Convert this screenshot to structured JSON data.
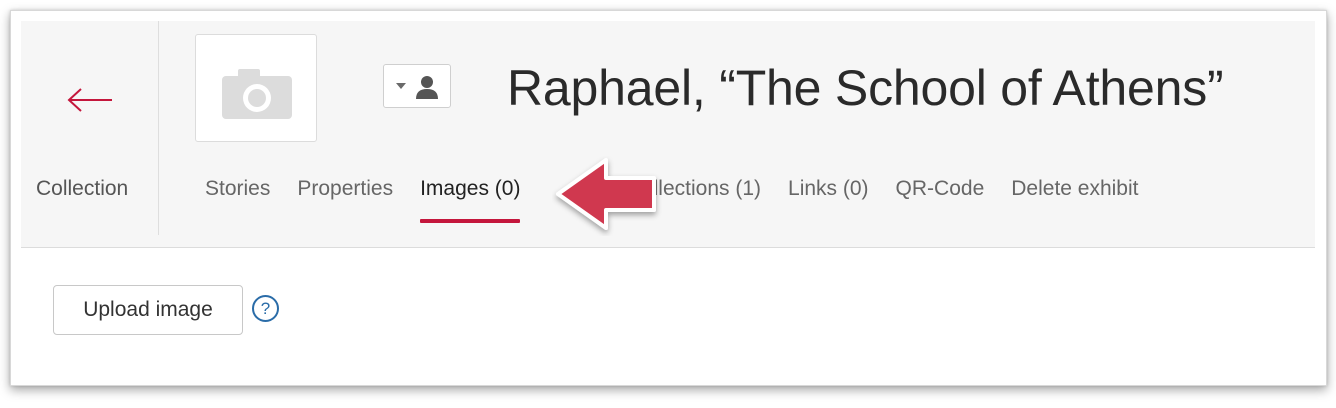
{
  "navigation": {
    "back_label": "Collection"
  },
  "exhibit": {
    "title": "Raphael, “The School of Athens”"
  },
  "tabs": [
    {
      "label": "Stories"
    },
    {
      "label": "Properties"
    },
    {
      "label": "Images (0)",
      "active": true
    },
    {
      "label": "collections (1)"
    },
    {
      "label": "Links (0)"
    },
    {
      "label": "QR-Code"
    },
    {
      "label": "Delete exhibit"
    }
  ],
  "images_panel": {
    "upload_label": "Upload image",
    "help_label": "?"
  },
  "colors": {
    "accent": "#c4163c",
    "callout_arrow": "#d0394f",
    "help": "#2a6ca8"
  },
  "icons": [
    "back-arrow-icon",
    "camera-icon",
    "caret-down-icon",
    "person-icon",
    "help-icon"
  ]
}
